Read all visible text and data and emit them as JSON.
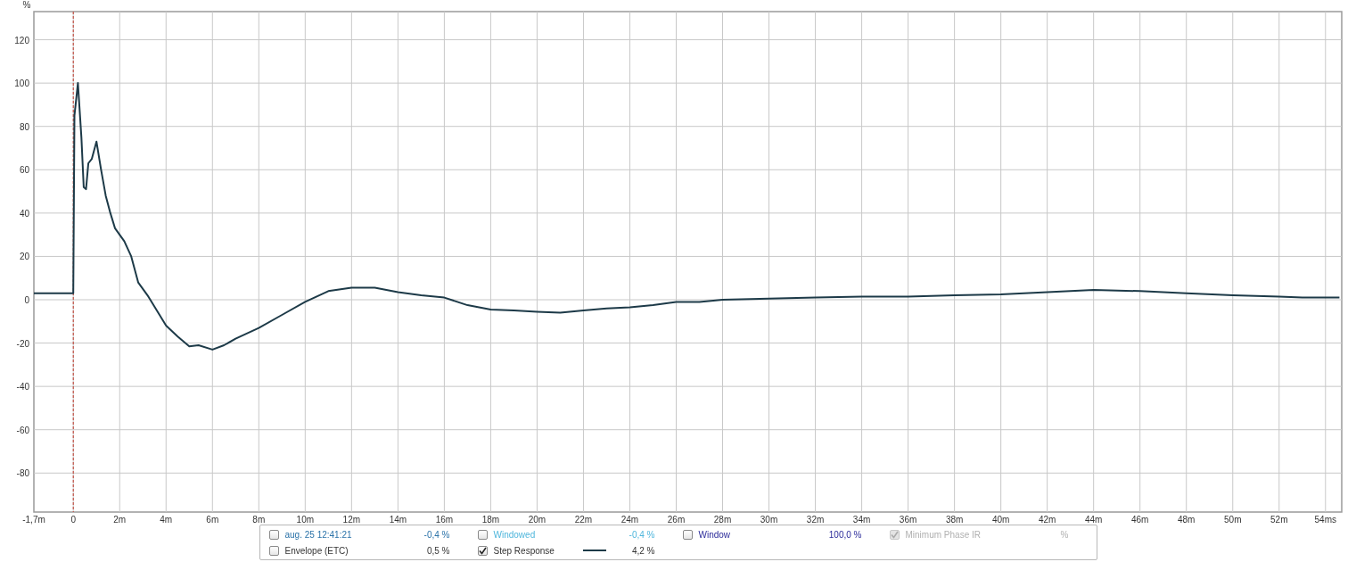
{
  "chart": {
    "y_unit": "%",
    "chart_data": {
      "type": "line",
      "xlim": [
        -1.7,
        54.7
      ],
      "ylim": [
        -98,
        133
      ],
      "xticks": [
        {
          "value": -1.7,
          "label": "-1,7m"
        },
        {
          "value": 0,
          "label": "0"
        },
        {
          "value": 2,
          "label": "2m"
        },
        {
          "value": 4,
          "label": "4m"
        },
        {
          "value": 6,
          "label": "6m"
        },
        {
          "value": 8,
          "label": "8m"
        },
        {
          "value": 10,
          "label": "10m"
        },
        {
          "value": 12,
          "label": "12m"
        },
        {
          "value": 14,
          "label": "14m"
        },
        {
          "value": 16,
          "label": "16m"
        },
        {
          "value": 18,
          "label": "18m"
        },
        {
          "value": 20,
          "label": "20m"
        },
        {
          "value": 22,
          "label": "22m"
        },
        {
          "value": 24,
          "label": "24m"
        },
        {
          "value": 26,
          "label": "26m"
        },
        {
          "value": 28,
          "label": "28m"
        },
        {
          "value": 30,
          "label": "30m"
        },
        {
          "value": 32,
          "label": "32m"
        },
        {
          "value": 34,
          "label": "34m"
        },
        {
          "value": 36,
          "label": "36m"
        },
        {
          "value": 38,
          "label": "38m"
        },
        {
          "value": 40,
          "label": "40m"
        },
        {
          "value": 42,
          "label": "42m"
        },
        {
          "value": 44,
          "label": "44m"
        },
        {
          "value": 46,
          "label": "46m"
        },
        {
          "value": 48,
          "label": "48m"
        },
        {
          "value": 50,
          "label": "50m"
        },
        {
          "value": 52,
          "label": "52m"
        },
        {
          "value": 54,
          "label": "54ms"
        }
      ],
      "yticks": [
        -80,
        -60,
        -40,
        -20,
        0,
        20,
        40,
        60,
        80,
        100,
        120
      ],
      "grid": true,
      "ref_lines": [
        {
          "axis": "x",
          "value": 0,
          "color": "#c0392b"
        }
      ],
      "x": [
        -1.7,
        -0.05,
        0,
        0.05,
        0.2,
        0.35,
        0.45,
        0.55,
        0.65,
        0.8,
        1.0,
        1.2,
        1.4,
        1.6,
        1.8,
        2.2,
        2.5,
        2.8,
        3.2,
        3.6,
        4,
        4.5,
        5,
        5.4,
        6,
        6.5,
        7,
        8,
        9,
        10,
        11,
        12,
        13,
        14,
        15,
        16,
        17,
        18,
        19,
        20,
        21,
        22,
        23,
        24,
        25,
        26,
        27,
        28,
        30,
        32,
        34,
        36,
        38,
        40,
        42,
        44,
        46,
        48,
        50,
        52,
        53,
        54.6
      ],
      "series": [
        {
          "name": "Step Response",
          "color": "#1d3a48",
          "values": [
            3,
            3,
            3,
            85,
            100,
            75,
            52,
            51,
            63,
            65,
            73,
            60,
            48,
            40,
            33,
            27,
            20,
            8,
            2,
            -5,
            -12,
            -17,
            -21.5,
            -21,
            -23,
            -21,
            -18,
            -13,
            -7,
            -1,
            4,
            5.5,
            5.5,
            3.5,
            2,
            1,
            -2.5,
            -4.5,
            -5,
            -5.5,
            -6,
            -5,
            -4,
            -3.5,
            -2.5,
            -1,
            -1,
            0,
            0.5,
            1,
            1.5,
            1.5,
            2,
            2.5,
            3.5,
            4.5,
            4,
            3,
            2,
            1.5,
            1,
            1
          ]
        }
      ]
    }
  },
  "legend": {
    "items": [
      {
        "kind": "plain",
        "label": "aug. 25 12:41:21",
        "value": "-0,4 %",
        "checked": false,
        "disabled": false,
        "color": "#2a72a8"
      },
      {
        "kind": "plain",
        "label": "Windowed",
        "value": "-0,4 %",
        "checked": false,
        "disabled": false,
        "color": "#4fb6dc"
      },
      {
        "kind": "plain",
        "label": "Window",
        "value": "100,0 %",
        "checked": false,
        "disabled": false,
        "color": "#2b2b9a"
      },
      {
        "kind": "plain",
        "label": "Minimum Phase IR",
        "value": "%",
        "checked": true,
        "disabled": true,
        "color": "#b0b0b0"
      },
      {
        "kind": "plain",
        "label": "Envelope (ETC)",
        "value": "0,5 %",
        "checked": false,
        "disabled": false,
        "color": "#333333"
      },
      {
        "kind": "swatch",
        "value": "4,2 %",
        "checked": true,
        "disabled": false,
        "color": "#333333"
      }
    ]
  }
}
